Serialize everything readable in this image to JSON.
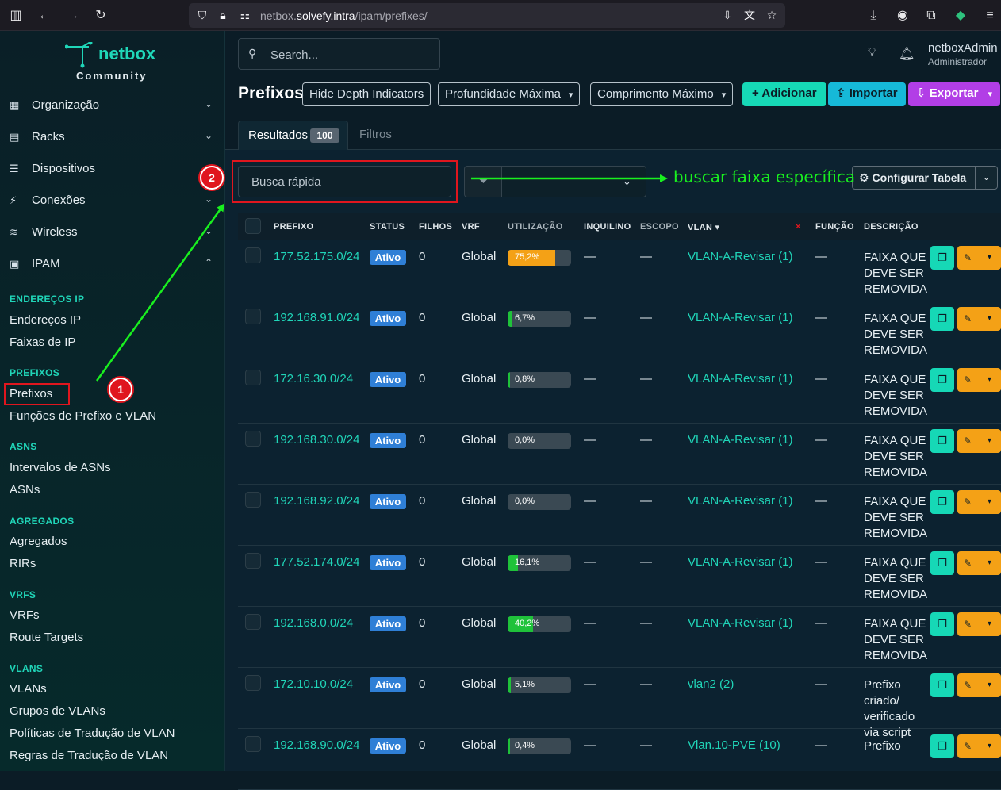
{
  "browser": {
    "url_prefix": "netbox.",
    "url_host": "solvefy.intra",
    "url_path": "/ipam/prefixes/"
  },
  "sidebar": {
    "brand": "netbox",
    "edition": "Community",
    "menu": [
      {
        "label": "Organização",
        "icon": "building-icon"
      },
      {
        "label": "Racks",
        "icon": "rack-icon"
      },
      {
        "label": "Dispositivos",
        "icon": "server-icon"
      },
      {
        "label": "Conexões",
        "icon": "cable-icon"
      },
      {
        "label": "Wireless",
        "icon": "wifi-icon"
      },
      {
        "label": "IPAM",
        "icon": "counter-icon"
      }
    ],
    "sections": {
      "ip": {
        "title": "ENDEREÇOS IP",
        "items": [
          "Endereços IP",
          "Faixas de IP"
        ]
      },
      "prefixes": {
        "title": "PREFIXOS",
        "items": [
          "Prefixos",
          "Funções de Prefixo e VLAN"
        ]
      },
      "asns": {
        "title": "ASNS",
        "items": [
          "Intervalos de ASNs",
          "ASNs"
        ]
      },
      "aggregates": {
        "title": "AGREGADOS",
        "items": [
          "Agregados",
          "RIRs"
        ]
      },
      "vrfs": {
        "title": "VRFS",
        "items": [
          "VRFs",
          "Route Targets"
        ]
      },
      "vlans": {
        "title": "VLANS",
        "items": [
          "VLANs",
          "Grupos de VLANs",
          "Políticas de Tradução de VLAN",
          "Regras de Tradução de VLAN"
        ]
      }
    }
  },
  "header": {
    "search_placeholder": "Search...",
    "user_name": "netboxAdmin",
    "user_role": "Administrador"
  },
  "page": {
    "title": "Prefixos",
    "buttons": {
      "hide_depth": "Hide Depth Indicators",
      "max_depth": "Profundidade Máxima",
      "max_length": "Comprimento Máximo",
      "add": "Adicionar",
      "import": "Importar",
      "export": "Exportar"
    },
    "tabs": {
      "results": "Resultados",
      "results_count": "100",
      "filters": "Filtros"
    },
    "quick_search_placeholder": "Busca rápida",
    "configure_table": "Configurar Tabela"
  },
  "annotations": {
    "step1": "1",
    "step2": "2",
    "note": "buscar faixa específica",
    "color": "#19f01f"
  },
  "table": {
    "columns": [
      "PREFIXO",
      "STATUS",
      "FILHOS",
      "VRF",
      "UTILIZAÇÃO",
      "INQUILINO",
      "ESCOPO",
      "VLAN",
      "FUNÇÃO",
      "DESCRIÇÃO"
    ],
    "rows": [
      {
        "prefix": "177.52.175.0/24",
        "status": "Ativo",
        "children": "0",
        "vrf": "Global",
        "util_label": "75,2%",
        "util": 75.2,
        "tenant": "—",
        "scope": "—",
        "vlan": "VLAN-A-Revisar (1)",
        "role": "—",
        "desc": "FAIXA QUE DEVE SER REMOVIDA"
      },
      {
        "prefix": "192.168.91.0/24",
        "status": "Ativo",
        "children": "0",
        "vrf": "Global",
        "util_label": "6,7%",
        "util": 6.7,
        "tenant": "—",
        "scope": "—",
        "vlan": "VLAN-A-Revisar (1)",
        "role": "—",
        "desc": "FAIXA QUE DEVE SER REMOVIDA"
      },
      {
        "prefix": "172.16.30.0/24",
        "status": "Ativo",
        "children": "0",
        "vrf": "Global",
        "util_label": "0,8%",
        "util": 0.8,
        "tenant": "—",
        "scope": "—",
        "vlan": "VLAN-A-Revisar (1)",
        "role": "—",
        "desc": "FAIXA QUE DEVE SER REMOVIDA"
      },
      {
        "prefix": "192.168.30.0/24",
        "status": "Ativo",
        "children": "0",
        "vrf": "Global",
        "util_label": "0,0%",
        "util": 0.0,
        "tenant": "—",
        "scope": "—",
        "vlan": "VLAN-A-Revisar (1)",
        "role": "—",
        "desc": "FAIXA QUE DEVE SER REMOVIDA"
      },
      {
        "prefix": "192.168.92.0/24",
        "status": "Ativo",
        "children": "0",
        "vrf": "Global",
        "util_label": "0,0%",
        "util": 0.0,
        "tenant": "—",
        "scope": "—",
        "vlan": "VLAN-A-Revisar (1)",
        "role": "—",
        "desc": "FAIXA QUE DEVE SER REMOVIDA"
      },
      {
        "prefix": "177.52.174.0/24",
        "status": "Ativo",
        "children": "0",
        "vrf": "Global",
        "util_label": "16,1%",
        "util": 16.1,
        "tenant": "—",
        "scope": "—",
        "vlan": "VLAN-A-Revisar (1)",
        "role": "—",
        "desc": "FAIXA QUE DEVE SER REMOVIDA"
      },
      {
        "prefix": "192.168.0.0/24",
        "status": "Ativo",
        "children": "0",
        "vrf": "Global",
        "util_label": "40,2%",
        "util": 40.2,
        "tenant": "—",
        "scope": "—",
        "vlan": "VLAN-A-Revisar (1)",
        "role": "—",
        "desc": "FAIXA QUE DEVE SER REMOVIDA"
      },
      {
        "prefix": "172.10.10.0/24",
        "status": "Ativo",
        "children": "0",
        "vrf": "Global",
        "util_label": "5,1%",
        "util": 5.1,
        "tenant": "—",
        "scope": "—",
        "vlan": "vlan2 (2)",
        "role": "—",
        "desc": "Prefixo criado/ verificado via script"
      },
      {
        "prefix": "192.168.90.0/24",
        "status": "Ativo",
        "children": "0",
        "vrf": "Global",
        "util_label": "0,4%",
        "util": 0.4,
        "tenant": "—",
        "scope": "—",
        "vlan": "Vlan.10-PVE (10)",
        "role": "—",
        "desc": "Prefixo"
      }
    ]
  },
  "colors": {
    "accent": "#20d5b8",
    "util_low": "#1fc23a",
    "util_mid": "#f4a116",
    "status": "#2f7fd6"
  }
}
